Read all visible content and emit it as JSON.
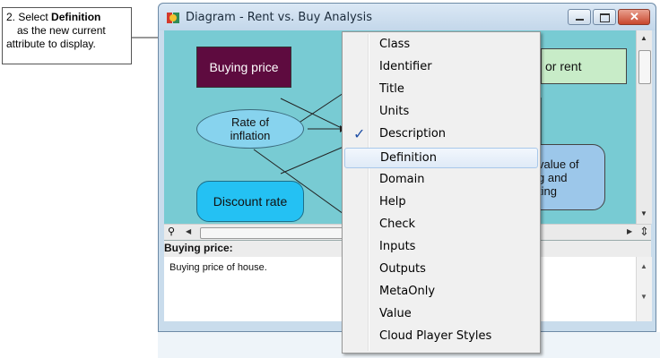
{
  "callout": {
    "step": "2. Select ",
    "bold": "Definition",
    "rest": "as the new current attribute to display."
  },
  "window": {
    "title": "Diagram - Rent vs. Buy Analysis",
    "icon": "analytica-icon",
    "buttons": [
      "minimize-icon",
      "maximize-icon",
      "close-icon"
    ]
  },
  "diagram": {
    "nodes": {
      "buying_price": "Buying price",
      "rate_of_inflation": "Rate of inflation",
      "discount_rate": "Discount rate",
      "partial_right_top": "or rent",
      "partial_right_mid": "value of\ng and\nting"
    }
  },
  "attribute_pane": {
    "label": "Buying price:",
    "text": "Buying price of house."
  },
  "context_menu": {
    "items": [
      {
        "label": "Class"
      },
      {
        "label": "Identifier"
      },
      {
        "label": "Title"
      },
      {
        "label": "Units"
      },
      {
        "label": "Description",
        "checked": true
      },
      {
        "label": "Definition",
        "highlighted": true
      },
      {
        "label": "Domain"
      },
      {
        "label": "Help"
      },
      {
        "label": "Check"
      },
      {
        "label": "Inputs"
      },
      {
        "label": "Outputs"
      },
      {
        "label": "MetaOnly"
      },
      {
        "label": "Value"
      },
      {
        "label": "Cloud Player Styles"
      }
    ]
  },
  "colors": {
    "canvas": "#78cbd3",
    "buying_price_node": "#5e0b3f",
    "chance_node": "#87d3ee",
    "decision_node": "#24c1f3",
    "objective_node": "#9cc7ea",
    "variable_node": "#c8ecc8"
  }
}
